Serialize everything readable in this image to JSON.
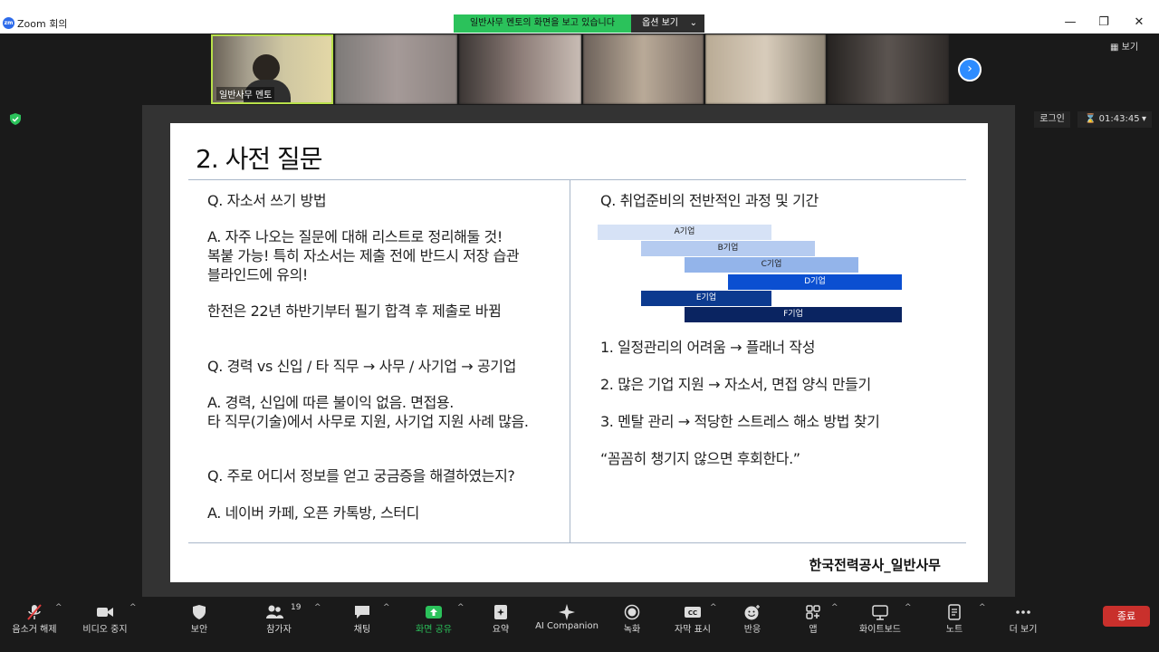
{
  "window": {
    "app_title": "Zoom 회의",
    "logo_text": "zm"
  },
  "share_banner": {
    "text": "일반사무 멘토의 화면을 보고 있습니다",
    "view_options": "옵션 보기"
  },
  "participants_strip": {
    "first_name": "일반사무 멘토",
    "view_button": "보기"
  },
  "meeting": {
    "login_button": "로그인",
    "elapsed": "01:43:45"
  },
  "slide": {
    "title": "2. 사전 질문",
    "left": {
      "q1": "Q. 자소서 쓰기 방법",
      "a1_l1": "A. 자주 나오는 질문에 대해 리스트로 정리해둘 것!",
      "a1_l2": "복붙 가능! 특히 자소서는 제출 전에 반드시 저장 습관",
      "a1_l3": "블라인드에 유의!",
      "note1": "한전은 22년 하반기부터 필기 합격 후 제출로 바뀜",
      "q2": "Q. 경력 vs 신입 / 타 직무 → 사무 / 사기업 → 공기업",
      "a2_l1": "A. 경력, 신입에 따른 불이익 없음. 면접용.",
      "a2_l2": "타 직무(기술)에서 사무로 지원, 사기업 지원 사례 많음.",
      "q3": "Q. 주로 어디서 정보를 얻고 궁금증을 해결하였는지?",
      "a3": "A. 네이버 카페, 오픈 카톡방, 스터디"
    },
    "right": {
      "q": "Q. 취업준비의 전반적인 과정 및 기간",
      "gantt": [
        {
          "label": "A기업",
          "start": 0,
          "end": 4
        },
        {
          "label": "B기업",
          "start": 1,
          "end": 5
        },
        {
          "label": "C기업",
          "start": 2,
          "end": 6
        },
        {
          "label": "D기업",
          "start": 3,
          "end": 7
        },
        {
          "label": "E기업",
          "start": 1,
          "end": 4
        },
        {
          "label": "F기업",
          "start": 2,
          "end": 7
        }
      ],
      "p1": "1. 일정관리의 어려움 → 플래너 작성",
      "p2": "2. 많은 기업 지원 → 자소서, 면접 양식 만들기",
      "p3": "3. 멘탈 관리 → 적당한 스트레스 해소 방법 찾기",
      "quote": "“꼼꼼히 챙기지 않으면 후회한다.”"
    },
    "footer": "한국전력공사_일반사무"
  },
  "colors": {
    "gantt": [
      "#d6e2f6",
      "#b5cbf0",
      "#93b4ea",
      "#0b4fd1",
      "#0c3a8f",
      "#0a2461"
    ],
    "gantt_text": [
      "#222222",
      "#222222",
      "#222222",
      "#ffffff",
      "#ffffff",
      "#ffffff"
    ],
    "share_green": "#2bc25b",
    "end_red": "#c9302c"
  },
  "toolbar": {
    "mute": "음소거 해제",
    "video": "비디오 중지",
    "security": "보안",
    "participants": "참가자",
    "participants_count": "19",
    "chat": "채팅",
    "share": "화면 공유",
    "summary": "요약",
    "ai": "AI Companion",
    "record": "녹화",
    "captions": "자막 표시",
    "reactions": "반응",
    "apps": "앱",
    "whiteboard": "화이트보드",
    "notes": "노트",
    "more": "더 보기",
    "end": "종료"
  }
}
